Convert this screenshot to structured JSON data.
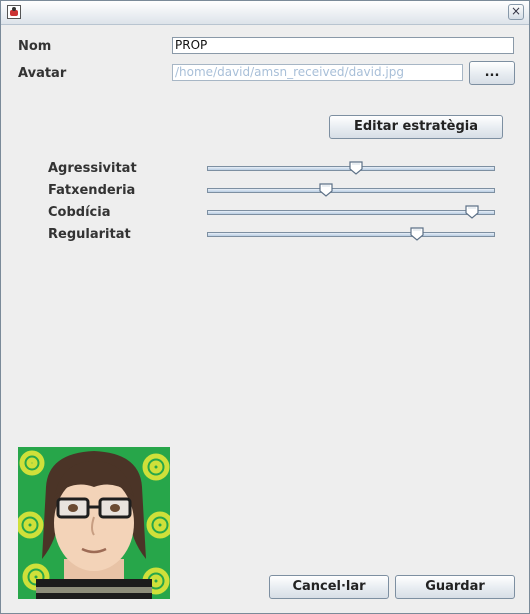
{
  "window": {
    "close_glyph": "×"
  },
  "form": {
    "nom_label": "Nom",
    "nom_value": "PROP",
    "avatar_label": "Avatar",
    "avatar_path": "/home/david/amsn_received/david.jpg",
    "browse_label": "...",
    "edit_strategy_label": "Editar estratègia"
  },
  "sliders": [
    {
      "label": "Agressivitat",
      "value": 0.52
    },
    {
      "label": "Fatxenderia",
      "value": 0.41
    },
    {
      "label": "Cobdícia",
      "value": 0.94
    },
    {
      "label": "Regularitat",
      "value": 0.74
    }
  ],
  "footer": {
    "cancel_label": "Cancel·lar",
    "save_label": "Guardar"
  },
  "colors": {
    "background": "#eeeeee",
    "disabled_text": "#a8bfd8",
    "avatar_background": "#27a64a"
  }
}
